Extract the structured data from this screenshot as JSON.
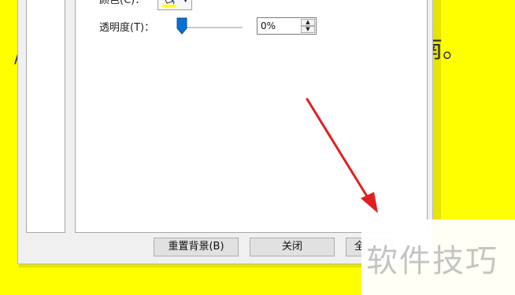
{
  "document": {
    "right_text": "南。",
    "left_fragment": "/"
  },
  "dialog": {
    "color_label": "颜色(C)：",
    "transparency_label": "透明度(T)：",
    "transparency_value": "0%",
    "transparency_fraction": 0,
    "buttons": {
      "reset": "重置背景(B)",
      "close": "关闭",
      "apply_partial": "全"
    }
  },
  "watermark": {
    "text": "软件技巧"
  },
  "colors": {
    "document_background": "#ffff00",
    "arrow": "#e02020",
    "slider_thumb": "#0a6fd3"
  },
  "icons": {
    "color_picker": "paint-bucket-icon",
    "dropdown": "chevron-down-icon"
  }
}
